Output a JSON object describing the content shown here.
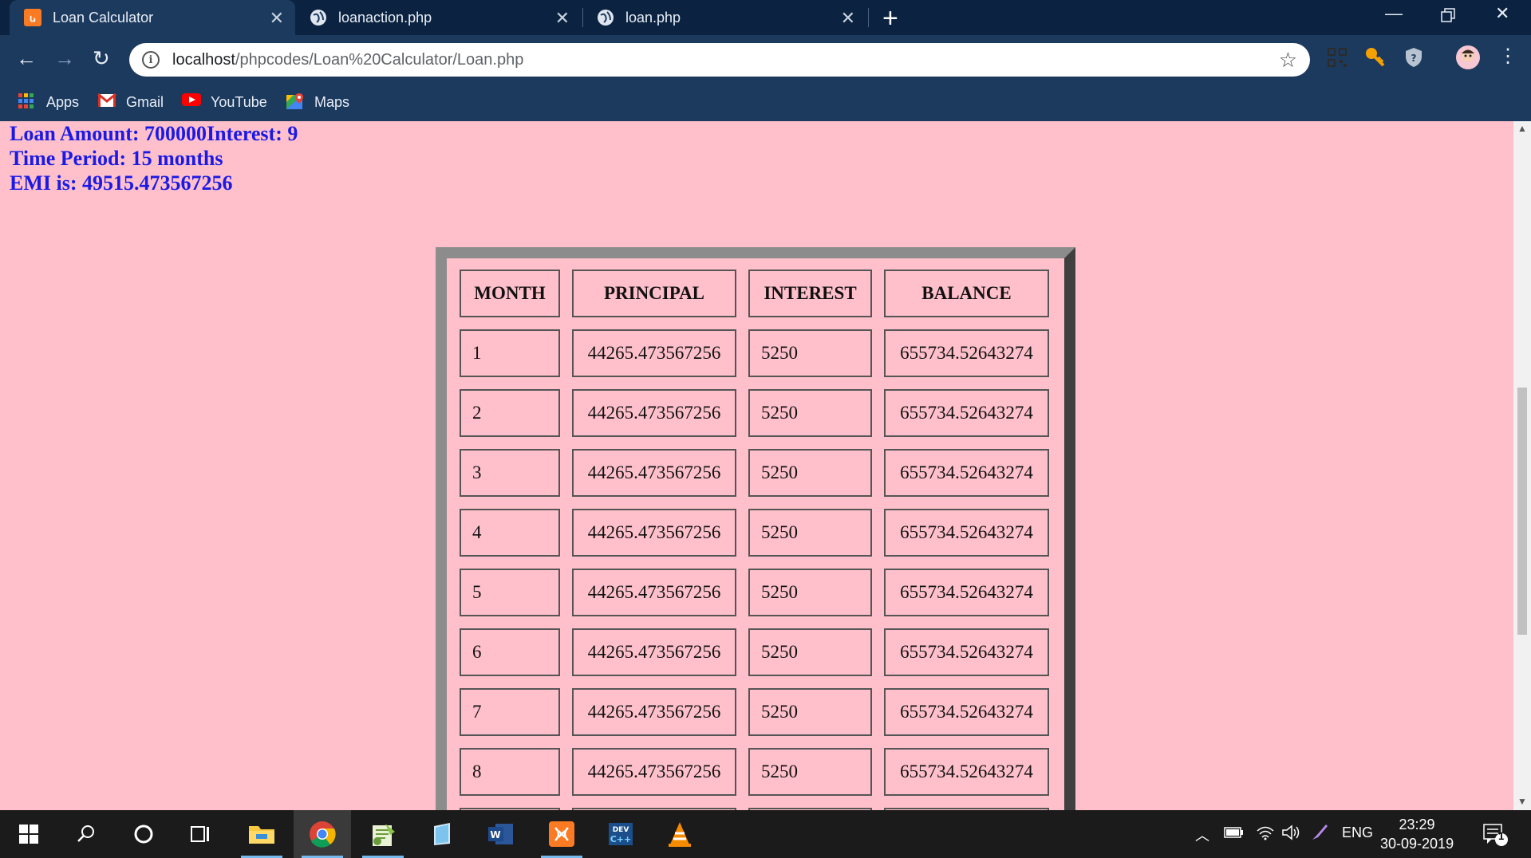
{
  "browser": {
    "tabs": [
      {
        "title": "Loan Calculator",
        "icon": "xampp-icon",
        "active": true
      },
      {
        "title": "loanaction.php",
        "icon": "globe-icon",
        "active": false
      },
      {
        "title": "loan.php",
        "icon": "globe-icon",
        "active": false
      }
    ],
    "address": {
      "host": "localhost",
      "path": "/phpcodes/Loan%20Calculator/Loan.php"
    },
    "bookmarks": [
      {
        "label": "Apps",
        "icon": "apps-grid-icon"
      },
      {
        "label": "Gmail",
        "icon": "gmail-icon"
      },
      {
        "label": "YouTube",
        "icon": "youtube-icon"
      },
      {
        "label": "Maps",
        "icon": "maps-icon"
      }
    ]
  },
  "result": {
    "loan_line": "Loan Amount: 700000Interest: 9",
    "time_line": "Time Period: 15 months",
    "emi_line": "EMI is: 49515.473567256"
  },
  "table": {
    "headers": [
      "MONTH",
      "PRINCIPAL",
      "INTEREST",
      "BALANCE"
    ],
    "rows": [
      [
        "1",
        "44265.473567256",
        "5250",
        "655734.52643274"
      ],
      [
        "2",
        "44265.473567256",
        "5250",
        "655734.52643274"
      ],
      [
        "3",
        "44265.473567256",
        "5250",
        "655734.52643274"
      ],
      [
        "4",
        "44265.473567256",
        "5250",
        "655734.52643274"
      ],
      [
        "5",
        "44265.473567256",
        "5250",
        "655734.52643274"
      ],
      [
        "6",
        "44265.473567256",
        "5250",
        "655734.52643274"
      ],
      [
        "7",
        "44265.473567256",
        "5250",
        "655734.52643274"
      ],
      [
        "8",
        "44265.473567256",
        "5250",
        "655734.52643274"
      ]
    ]
  },
  "taskbar": {
    "apps": [
      "windows-start-icon",
      "search-icon",
      "cortana-icon",
      "task-view-icon",
      "file-explorer-icon",
      "chrome-icon",
      "notepad-plus-icon",
      "notes-icon",
      "word-icon",
      "xampp-icon",
      "devcpp-icon",
      "vlc-icon"
    ],
    "language": "ENG",
    "time": "23:29",
    "date": "30-09-2019",
    "notification_count": "1"
  },
  "colors": {
    "page_bg": "#ffc0cb",
    "text_blue": "#1a1ae6",
    "chrome_dark": "#0b2340",
    "chrome": "#1c3a5e"
  }
}
